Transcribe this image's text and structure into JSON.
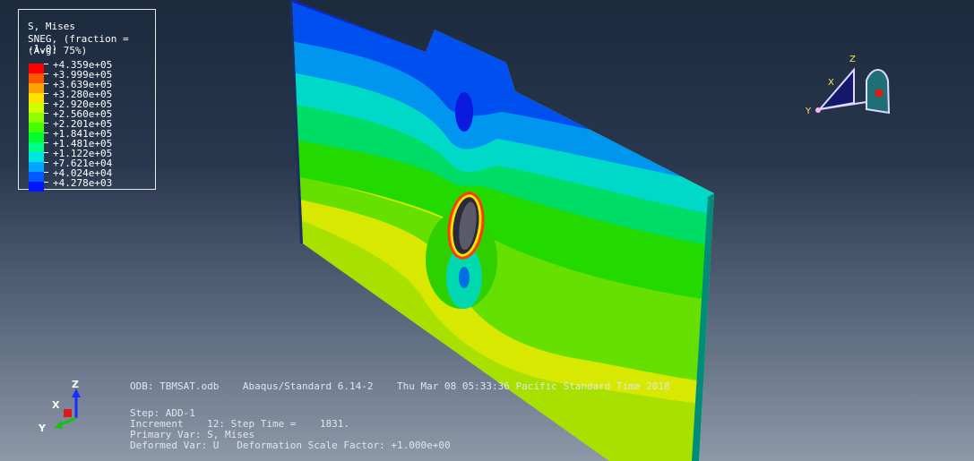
{
  "legend": {
    "title": "S, Mises",
    "subtitle": "SNEG, (fraction = -1.0)",
    "averaging": "(Avg: 75%)",
    "values": [
      "+4.359e+05",
      "+3.999e+05",
      "+3.639e+05",
      "+3.280e+05",
      "+2.920e+05",
      "+2.560e+05",
      "+2.201e+05",
      "+1.841e+05",
      "+1.481e+05",
      "+1.122e+05",
      "+7.621e+04",
      "+4.024e+04",
      "+4.278e+03"
    ],
    "colors": [
      "#ff0000",
      "#ff5500",
      "#ffa200",
      "#ffe000",
      "#d2ff00",
      "#8cff00",
      "#46ff00",
      "#00ff2c",
      "#00ff88",
      "#00e6e0",
      "#00a6ff",
      "#005aff",
      "#0016ff"
    ]
  },
  "info": {
    "odb_line": "ODB: TBMSAT.odb    Abaqus/Standard 6.14-2    Thu Mar 08 05:33:36 Pacific Standard Time 2018",
    "step_line": "Step: ADD-1",
    "increment_line": "Increment    12: Step Time =    1831.",
    "primary_var_line": "Primary Var: S, Mises",
    "deformed_var_line": "Deformed Var: U   Deformation Scale Factor: +1.000e+00"
  },
  "triad": {
    "x": "X",
    "y": "Y",
    "z": "Z"
  },
  "view_cube": {
    "x": "X",
    "y": "Y",
    "z": "Z"
  },
  "colors": {
    "background_top": "#1c2a3e",
    "background_bottom": "#8d98a8",
    "red_band": "#ff0000",
    "blue_band": "#0016ff"
  }
}
